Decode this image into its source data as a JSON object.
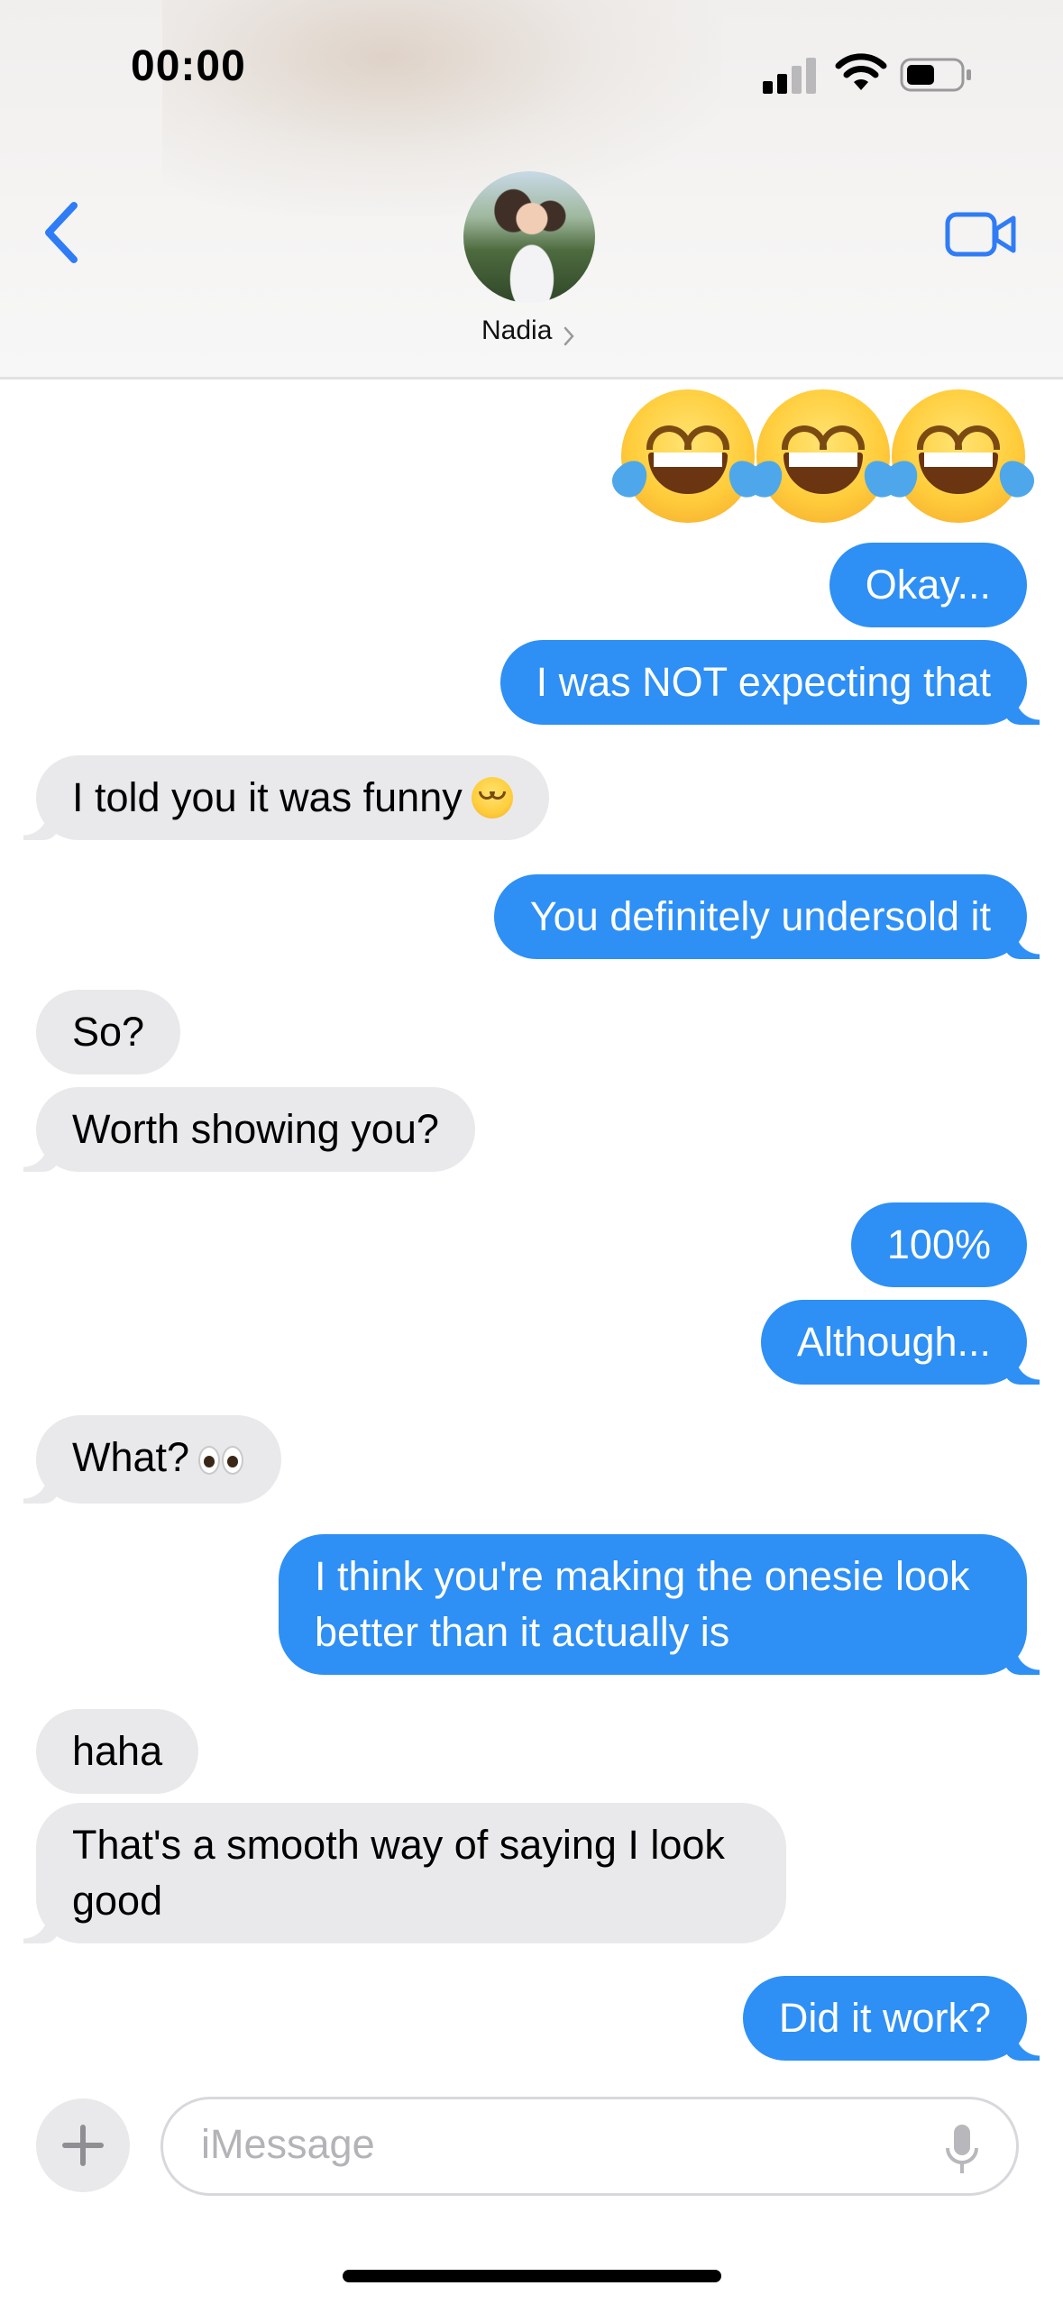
{
  "status_bar": {
    "time": "00:00"
  },
  "header": {
    "contact_name": "Nadia"
  },
  "messages": [
    {
      "side": "out",
      "text": "Okay..."
    },
    {
      "side": "out",
      "text": "I was NOT expecting that"
    },
    {
      "side": "in",
      "text": "I told you it was funny"
    },
    {
      "side": "out",
      "text": "You definitely undersold it"
    },
    {
      "side": "in",
      "text": "So?"
    },
    {
      "side": "in",
      "text": "Worth showing you?"
    },
    {
      "side": "out",
      "text": "100%"
    },
    {
      "side": "out",
      "text": "Although..."
    },
    {
      "side": "in",
      "text": "What?"
    },
    {
      "side": "out",
      "text": "I think you're making the onesie look better than it actually is"
    },
    {
      "side": "in",
      "text": "haha"
    },
    {
      "side": "in",
      "text": "That's a smooth way of saying I look good"
    },
    {
      "side": "out",
      "text": "Did it work?"
    }
  ],
  "emoji_message": {
    "icon": "face-with-tears-of-joy",
    "count": 3
  },
  "composer": {
    "placeholder": "iMessage"
  },
  "colors": {
    "outgoing": "#2e8ff5",
    "incoming": "#e9e9eb",
    "accent": "#2f7cf6"
  }
}
